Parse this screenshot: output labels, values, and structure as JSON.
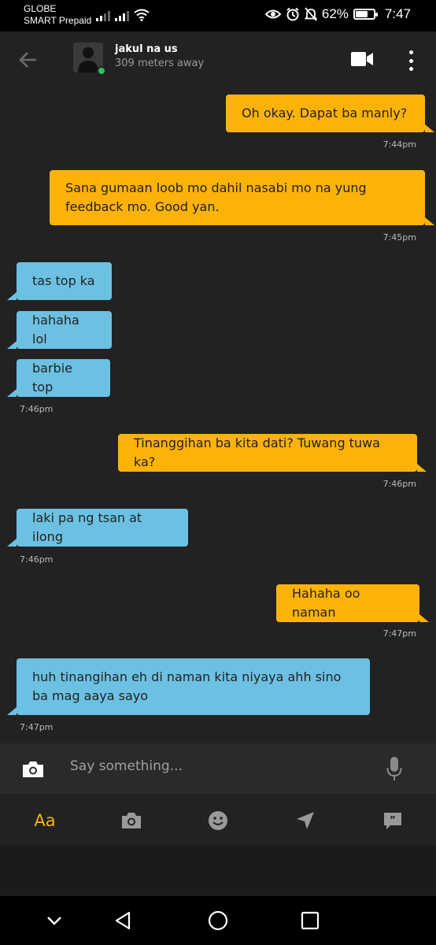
{
  "status_bar": {
    "carrier_line1": "GLOBE",
    "carrier_line2": "SMART Prepaid",
    "battery_percent": "62%",
    "battery_level": 0.62,
    "time": "7:47",
    "icons": [
      "signal-icon",
      "signal-icon",
      "wifi-icon",
      "eye-icon",
      "alarm-icon",
      "mute-bell-icon",
      "battery-icon"
    ]
  },
  "header": {
    "contact_name": "jakul na us",
    "distance": "309 meters away",
    "online": true,
    "icons": [
      "back-arrow-icon",
      "video-camera-icon",
      "more-vertical-icon"
    ]
  },
  "messages": [
    {
      "direction": "out",
      "text": "Oh okay. Dapat ba manly?",
      "time": "7:44pm"
    },
    {
      "direction": "out",
      "text": "Sana gumaan loob mo dahil nasabi mo na yung feedback mo. Good yan.",
      "time": "7:45pm"
    },
    {
      "direction": "in",
      "text": "tas top ka",
      "time": ""
    },
    {
      "direction": "in",
      "text": "hahaha lol",
      "time": ""
    },
    {
      "direction": "in",
      "text": "barbie top",
      "time": "7:46pm"
    },
    {
      "direction": "out",
      "text": "Tinanggihan ba kita dati? Tuwang tuwa ka?",
      "time": "7:46pm"
    },
    {
      "direction": "in",
      "text": "laki pa ng tsan at ilong",
      "time": "7:46pm"
    },
    {
      "direction": "out",
      "text": "Hahaha oo naman",
      "time": "7:47pm"
    },
    {
      "direction": "in",
      "text": "huh tinangihan eh di naman kita niyaya ahh sino ba mag aaya sayo",
      "time": "7:47pm"
    }
  ],
  "input": {
    "placeholder": "Say something...",
    "icons": [
      "camera-icon",
      "microphone-icon"
    ]
  },
  "toolbar": {
    "text_label": "Aa",
    "icons": [
      "camera-icon",
      "smiley-icon",
      "location-arrow-icon",
      "saved-phrases-icon"
    ]
  },
  "nav": {
    "icons": [
      "chevron-down-icon",
      "back-triangle-icon",
      "home-circle-icon",
      "recents-square-icon"
    ]
  },
  "colors": {
    "outgoing_bubble": "#fdb20a",
    "incoming_bubble": "#6cc1e3",
    "chat_background": "#222222",
    "online_dot": "#22c55e"
  }
}
